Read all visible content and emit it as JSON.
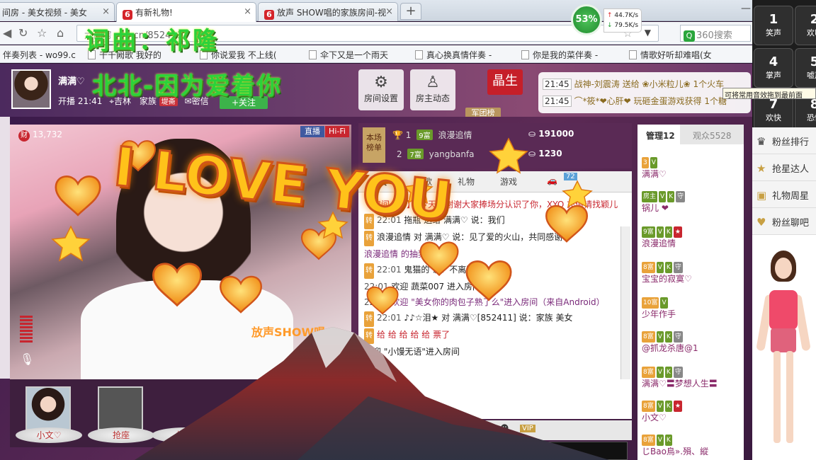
{
  "browser": {
    "tabs": [
      {
        "label": "间房 - 美女视频 - 美女"
      },
      {
        "label": "有新礼物!"
      },
      {
        "label": "放声 SHOW唱的家族房间-视"
      }
    ],
    "url": "6.cn/852411",
    "url_prefix": "六间房",
    "search_placeholder": "360搜索",
    "speed": {
      "percent": "53%",
      "up": "44.7K/s",
      "down": "79.5K/s"
    },
    "bookmarks": [
      "伴奏列表 - wo99.c",
      "千千阙歌 我好的",
      "你说爱我 不上线(",
      "伞下又是一个雨天",
      "真心换真情伴奏 -",
      "你是我的菜伴奏 -",
      "情歌好听却难唱(女"
    ]
  },
  "host": {
    "name": "满满♡",
    "open_time": "开播 21:41",
    "location": "吉林",
    "family": "家族",
    "family_tag": "堤斋",
    "message": "密信",
    "follow": "+关注"
  },
  "header_buttons": {
    "room_settings": "房间设置",
    "host_activity": "房主动态",
    "jingsheng": "晶生",
    "juntuan": "军团榜"
  },
  "ticker": [
    {
      "time": "21:45",
      "text": "战神-刘震涛 送给 ❀小米粒儿❀ 1个火车"
    },
    {
      "time": "21:45",
      "text": "⌒*筱*❤心肝❤ 玩砸金蛋游戏获得 1个糖"
    }
  ],
  "tooltip": "可将常用音效拖到最前面",
  "video": {
    "cai_count": "13,732",
    "live": "直播",
    "hifi": "Hi-Fi",
    "brand": "放声SHOW唱"
  },
  "seats": [
    "小文♡",
    "抢座",
    "抢座",
    "抢座",
    "抢座"
  ],
  "ranking": {
    "label": "本场榜单",
    "rows": [
      {
        "rank": "1",
        "level": "9富",
        "name": "浪漫追情",
        "coins": "191000"
      },
      {
        "rank": "2",
        "level": "7富",
        "name": "yangbanfa",
        "coins": "1230"
      }
    ]
  },
  "chat": {
    "tabs": [
      "聊天",
      "点歌",
      "礼物",
      "游戏"
    ],
    "car_badge": "72",
    "messages": [
      {
        "time": "",
        "text": "【房间公告】：今天，谢谢大家捧场分认识了你，XYO 充值请找颖儿"
      },
      {
        "time": "22:01",
        "text": "拖瓶 送给 满满♡ 说：我们"
      },
      {
        "time": "",
        "text": "浪漫追情 对 满满♡ 说：见了爱的火山，共同感谢"
      },
      {
        "time": "",
        "text": "浪漫追情 的抽奖"
      },
      {
        "time": "22:01",
        "text": "鬼猫的 说：不离不弃"
      },
      {
        "time": "22:01",
        "text": "欢迎 蔬菜007 进入房间"
      },
      {
        "time": "22:01",
        "text": "欢迎 \"美女你的肉包子熟了么\"进入房间（来自Android）"
      },
      {
        "time": "22:01",
        "text": "♪♪☆泪★ 对 满满♡[852411] 说：家族 美女"
      },
      {
        "time": "",
        "text": "给 给 给 给 给 票了"
      },
      {
        "time": "",
        "text": "欢迎 \"小馒无语\"进入房间"
      }
    ],
    "input_hint": "悄悄",
    "vip": "VIP"
  },
  "admin": {
    "tabs": [
      "管理12",
      "观众5528"
    ],
    "users": [
      {
        "badges": [
          "3",
          "V"
        ],
        "id": "852411",
        "name": "满满♡"
      },
      {
        "badges": [
          "房主",
          "V",
          "K",
          "守"
        ],
        "id": "2166",
        "name": "锅儿 ❤"
      },
      {
        "badges": [
          "9富",
          "V",
          "K",
          "★"
        ],
        "id": "15",
        "name": "浪漫追情"
      },
      {
        "badges": [
          "8富",
          "V",
          "K",
          "守"
        ],
        "id": "",
        "name": "宝宝的寂寞♡"
      },
      {
        "badges": [
          "10富",
          "V"
        ],
        "id": "",
        "name": "少年作手"
      },
      {
        "badges": [
          "8富",
          "V",
          "K",
          "守"
        ],
        "id": "951796",
        "name": "@抓龙杀唐@1"
      },
      {
        "badges": [
          "8富",
          "V",
          "K",
          "守"
        ],
        "id": "",
        "name": "满满♡〓梦想人生〓"
      },
      {
        "badges": [
          "8富",
          "V",
          "K",
          "★"
        ],
        "id": "",
        "name": "小文♡"
      },
      {
        "badges": [
          "8富",
          "V",
          "K"
        ],
        "id": "",
        "name": "じBao鳥».殞、縱"
      }
    ]
  },
  "side": {
    "keys": [
      {
        "num": "1",
        "label": "笑声"
      },
      {
        "num": "2",
        "label": "欢叫"
      },
      {
        "num": "4",
        "label": "掌声"
      },
      {
        "num": "5",
        "label": "嘘声"
      },
      {
        "num": "7",
        "label": "欢快"
      },
      {
        "num": "8",
        "label": "恐怖"
      }
    ],
    "items": [
      "粉丝排行",
      "抢星达人",
      "礼物周星",
      "粉丝聊吧"
    ]
  },
  "overlays": {
    "lyric_line1": "词曲：祁隆",
    "lyric_line2": "北北-因为爱着你",
    "love_text": "I LOVE YOU"
  },
  "colors": {
    "accent_red": "#c8262f",
    "lyric_green": "#2cd23a",
    "love_orange": "#ffc21a"
  }
}
